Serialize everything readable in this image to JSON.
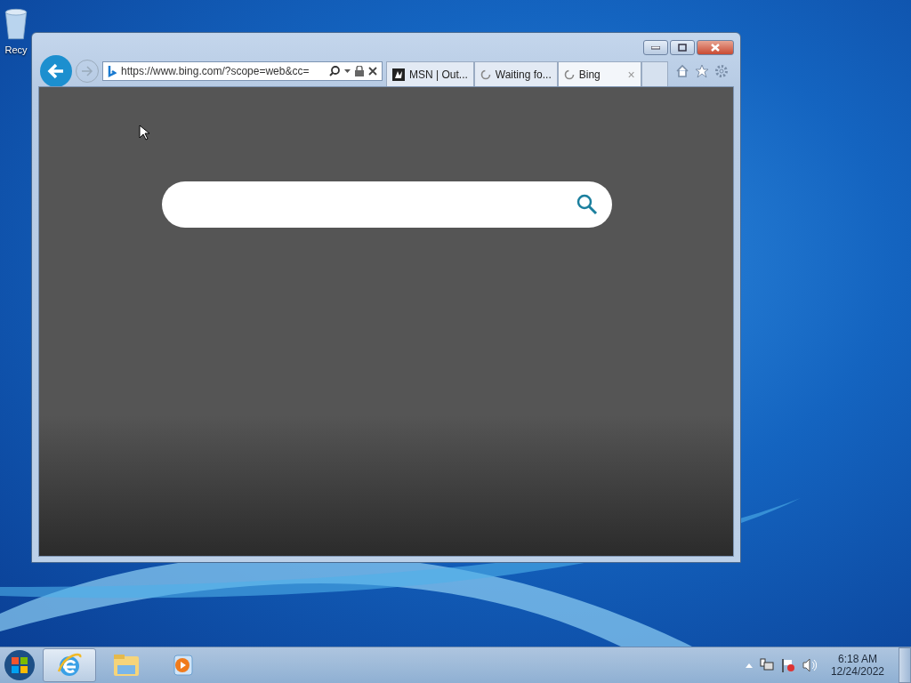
{
  "desktop": {
    "icons": [
      {
        "label": "Recy"
      }
    ]
  },
  "browser": {
    "address": "https://www.bing.com/?scope=web&cc=",
    "tabs": [
      {
        "title": "MSN | Out...",
        "kind": "msn",
        "selected": false,
        "closable": false
      },
      {
        "title": "Waiting fo...",
        "kind": "loading",
        "selected": false,
        "closable": false
      },
      {
        "title": "Bing",
        "kind": "loading",
        "selected": true,
        "closable": true
      }
    ],
    "close_glyph": "×"
  },
  "taskbar": {
    "apps": [
      {
        "kind": "ie",
        "selected": true
      },
      {
        "kind": "explorer",
        "selected": false
      },
      {
        "kind": "media",
        "selected": false
      }
    ],
    "clock": {
      "time": "6:18 AM",
      "date": "12/24/2022"
    }
  }
}
